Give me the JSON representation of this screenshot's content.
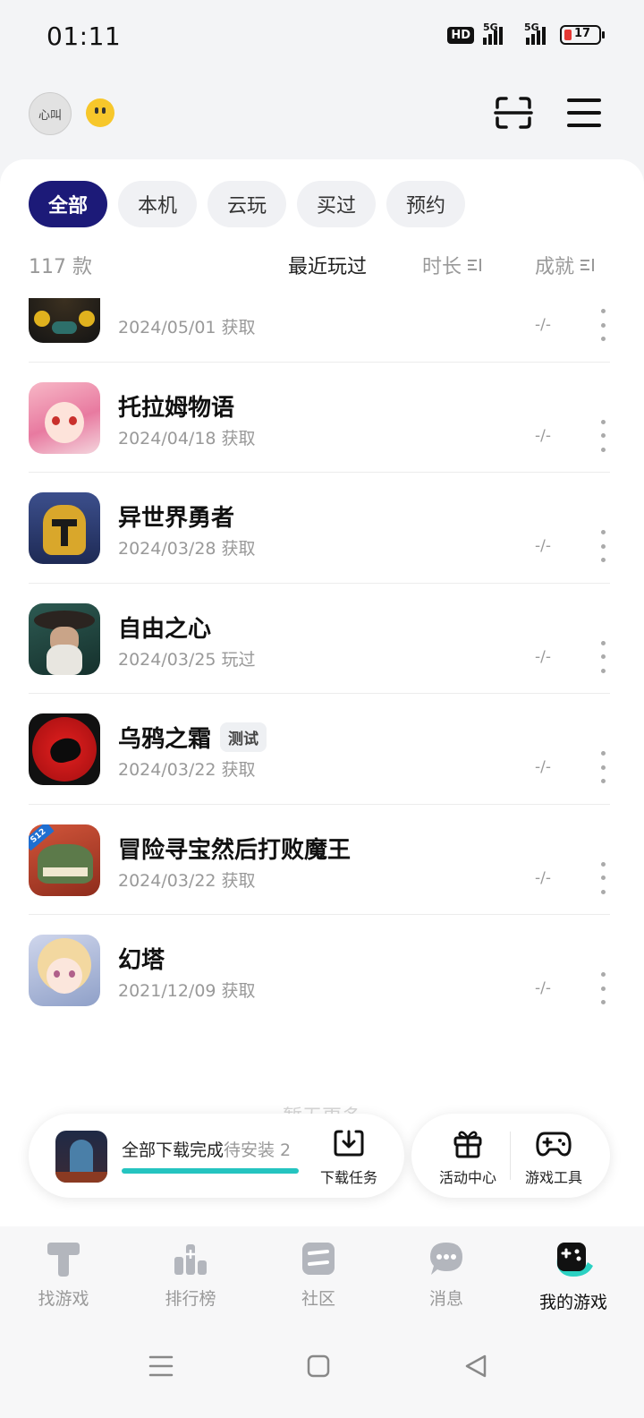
{
  "status": {
    "time": "01:11",
    "hd": "HD",
    "net1": "5G",
    "net2": "5G",
    "battery": "17"
  },
  "header": {
    "avatar_text": "心叫",
    "icons": {
      "scan": "scan-icon",
      "menu": "menu-icon"
    }
  },
  "filters": {
    "chips": [
      "全部",
      "本机",
      "云玩",
      "买过",
      "预约"
    ],
    "active": "全部"
  },
  "sortbar": {
    "count": "117 款",
    "recent": "最近玩过",
    "time": "时长",
    "achievement": "成就"
  },
  "games": [
    {
      "name": "",
      "tag": "",
      "date": "2024/05/01 获取",
      "achievement": "-/-"
    },
    {
      "name": "托拉姆物语",
      "tag": "",
      "date": "2024/04/18 获取",
      "achievement": "-/-"
    },
    {
      "name": "异世界勇者",
      "tag": "",
      "date": "2024/03/28 获取",
      "achievement": "-/-"
    },
    {
      "name": "自由之心",
      "tag": "",
      "date": "2024/03/25 玩过",
      "achievement": "-/-"
    },
    {
      "name": "乌鸦之霜",
      "tag": "测试",
      "date": "2024/03/22 获取",
      "achievement": "-/-"
    },
    {
      "name": "冒险寻宝然后打败魔王",
      "tag": "",
      "date": "2024/03/22 获取",
      "achievement": "-/-"
    },
    {
      "name": "幻塔",
      "tag": "",
      "date": "2021/12/09 获取",
      "achievement": "-/-"
    }
  ],
  "list_footer": "暂无更多",
  "download": {
    "status": "全部下载完成",
    "pending": "待安装 2",
    "task_label": "下载任务",
    "progress": 1.0
  },
  "tools": {
    "activity": "活动中心",
    "game_tools": "游戏工具"
  },
  "nav": {
    "items": [
      "找游戏",
      "排行榜",
      "社区",
      "消息",
      "我的游戏"
    ],
    "active": "我的游戏"
  },
  "colors": {
    "accent": "#1c1a78",
    "progress": "#25c4c0",
    "battery_low": "#e53935"
  }
}
